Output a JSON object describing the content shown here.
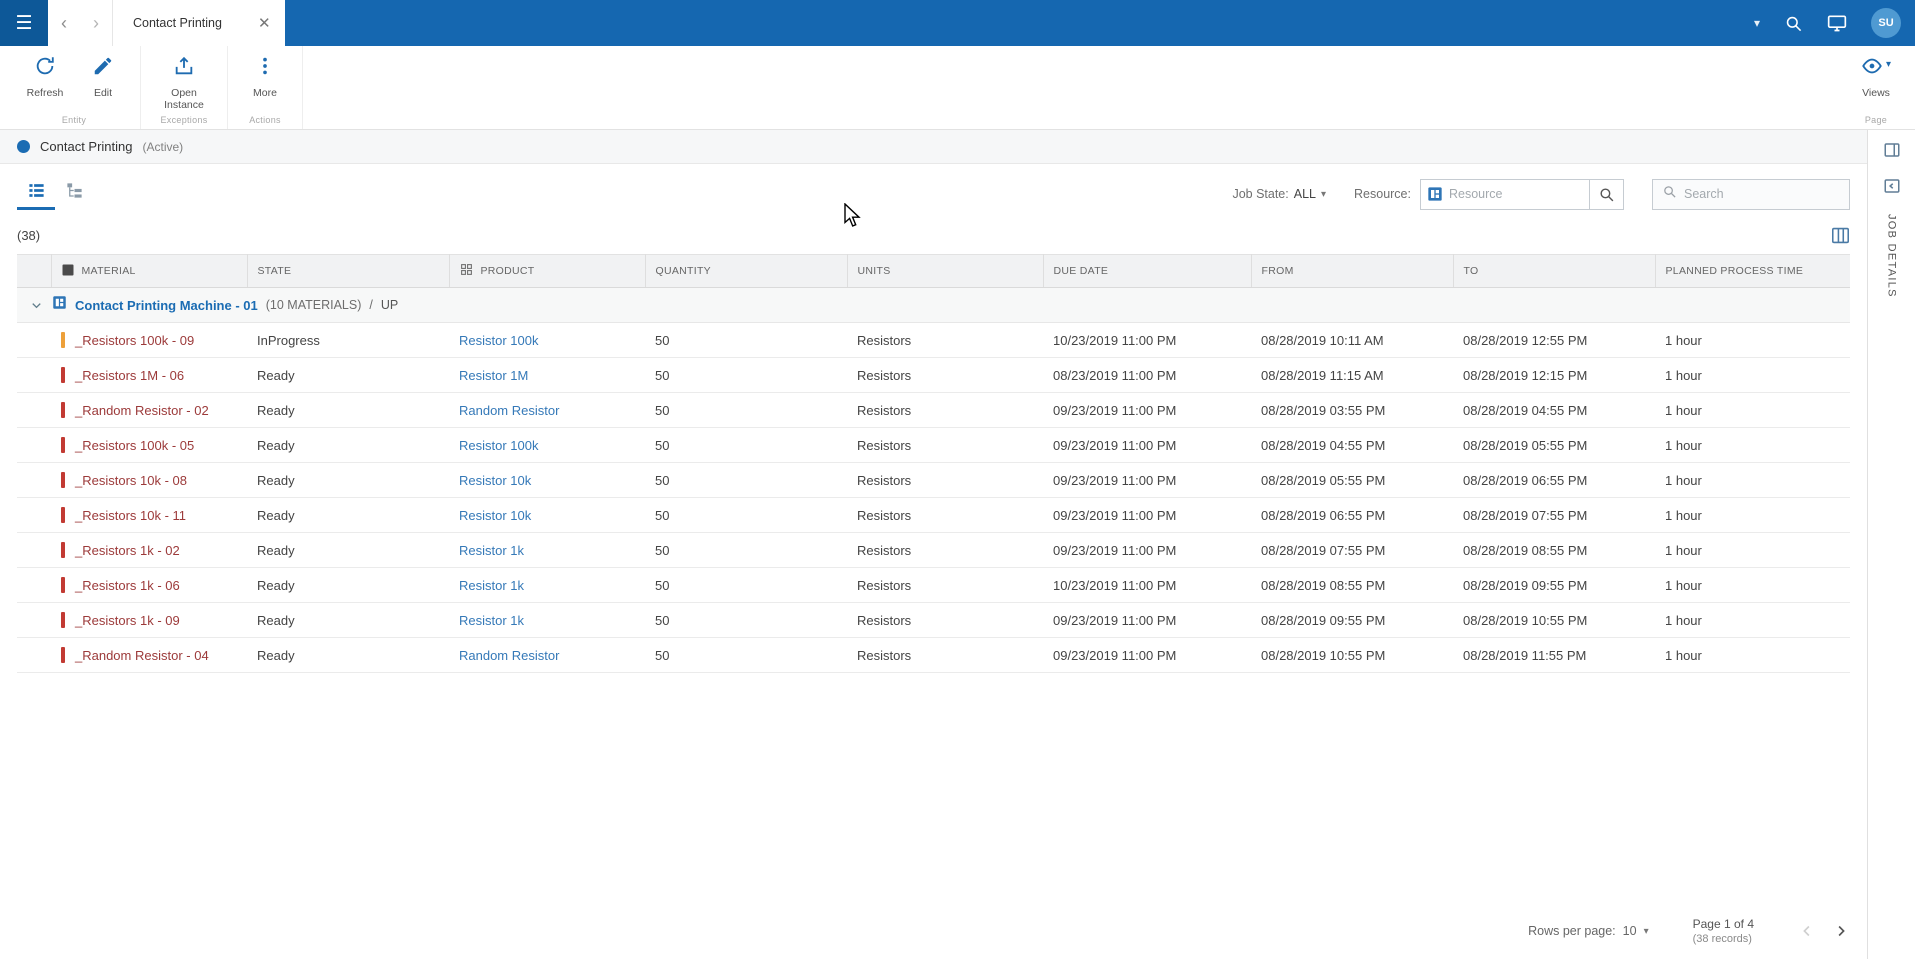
{
  "topbar": {
    "tab_title": "Contact Printing",
    "user_initials": "SU"
  },
  "ribbon": {
    "groups": [
      {
        "label": "Entity",
        "buttons": [
          {
            "label": "Refresh"
          },
          {
            "label": "Edit"
          }
        ]
      },
      {
        "label": "Exceptions",
        "buttons": [
          {
            "label": "Open Instance"
          }
        ]
      },
      {
        "label": "Actions",
        "buttons": [
          {
            "label": "More"
          }
        ]
      }
    ],
    "right": {
      "views_label": "Views",
      "group_label": "Page"
    }
  },
  "entity_header": {
    "title": "Contact Printing",
    "status": "(Active)"
  },
  "filters": {
    "job_state_label": "Job State:",
    "job_state_value": "ALL",
    "resource_label": "Resource:",
    "resource_placeholder": "Resource",
    "search_placeholder": "Search"
  },
  "grid": {
    "count": "(38)",
    "columns": [
      {
        "label": "MATERIAL",
        "icon": "checkbox-icon"
      },
      {
        "label": "STATE"
      },
      {
        "label": "PRODUCT",
        "icon": "product-icon"
      },
      {
        "label": "QUANTITY"
      },
      {
        "label": "UNITS"
      },
      {
        "label": "DUE DATE"
      },
      {
        "label": "FROM"
      },
      {
        "label": "TO"
      },
      {
        "label": "PLANNED PROCESS TIME"
      }
    ],
    "group": {
      "name": "Contact Printing Machine - 01",
      "materials": "(10 MATERIALS)",
      "sep": "/",
      "state": "UP"
    },
    "rows": [
      {
        "material": "_Resistors 100k - 09",
        "state": "InProgress",
        "product": "Resistor 100k",
        "quantity": "50",
        "units": "Resistors",
        "due_date": "10/23/2019 11:00 PM",
        "from": "08/28/2019 10:11 AM",
        "to": "08/28/2019 12:55 PM",
        "planned_process_time": "1 hour",
        "bar": "bar_inprogress"
      },
      {
        "material": "_Resistors 1M - 06",
        "state": "Ready",
        "product": "Resistor 1M",
        "quantity": "50",
        "units": "Resistors",
        "due_date": "08/23/2019 11:00 PM",
        "from": "08/28/2019 11:15 AM",
        "to": "08/28/2019 12:15 PM",
        "planned_process_time": "1 hour",
        "bar": "bar_ready"
      },
      {
        "material": "_Random Resistor - 02",
        "state": "Ready",
        "product": "Random Resistor",
        "quantity": "50",
        "units": "Resistors",
        "due_date": "09/23/2019 11:00 PM",
        "from": "08/28/2019 03:55 PM",
        "to": "08/28/2019 04:55 PM",
        "planned_process_time": "1 hour",
        "bar": "bar_ready"
      },
      {
        "material": "_Resistors 100k - 05",
        "state": "Ready",
        "product": "Resistor 100k",
        "quantity": "50",
        "units": "Resistors",
        "due_date": "09/23/2019 11:00 PM",
        "from": "08/28/2019 04:55 PM",
        "to": "08/28/2019 05:55 PM",
        "planned_process_time": "1 hour",
        "bar": "bar_ready"
      },
      {
        "material": "_Resistors 10k - 08",
        "state": "Ready",
        "product": "Resistor 10k",
        "quantity": "50",
        "units": "Resistors",
        "due_date": "09/23/2019 11:00 PM",
        "from": "08/28/2019 05:55 PM",
        "to": "08/28/2019 06:55 PM",
        "planned_process_time": "1 hour",
        "bar": "bar_ready"
      },
      {
        "material": "_Resistors 10k - 11",
        "state": "Ready",
        "product": "Resistor 10k",
        "quantity": "50",
        "units": "Resistors",
        "due_date": "09/23/2019 11:00 PM",
        "from": "08/28/2019 06:55 PM",
        "to": "08/28/2019 07:55 PM",
        "planned_process_time": "1 hour",
        "bar": "bar_ready"
      },
      {
        "material": "_Resistors 1k - 02",
        "state": "Ready",
        "product": "Resistor 1k",
        "quantity": "50",
        "units": "Resistors",
        "due_date": "09/23/2019 11:00 PM",
        "from": "08/28/2019 07:55 PM",
        "to": "08/28/2019 08:55 PM",
        "planned_process_time": "1 hour",
        "bar": "bar_ready"
      },
      {
        "material": "_Resistors 1k - 06",
        "state": "Ready",
        "product": "Resistor 1k",
        "quantity": "50",
        "units": "Resistors",
        "due_date": "10/23/2019 11:00 PM",
        "from": "08/28/2019 08:55 PM",
        "to": "08/28/2019 09:55 PM",
        "planned_process_time": "1 hour",
        "bar": "bar_ready"
      },
      {
        "material": "_Resistors 1k - 09",
        "state": "Ready",
        "product": "Resistor 1k",
        "quantity": "50",
        "units": "Resistors",
        "due_date": "09/23/2019 11:00 PM",
        "from": "08/28/2019 09:55 PM",
        "to": "08/28/2019 10:55 PM",
        "planned_process_time": "1 hour",
        "bar": "bar_ready"
      },
      {
        "material": "_Random Resistor - 04",
        "state": "Ready",
        "product": "Random Resistor",
        "quantity": "50",
        "units": "Resistors",
        "due_date": "09/23/2019 11:00 PM",
        "from": "08/28/2019 10:55 PM",
        "to": "08/28/2019 11:55 PM",
        "planned_process_time": "1 hour",
        "bar": "bar_ready"
      }
    ]
  },
  "pagination": {
    "rows_per_page_label": "Rows per page:",
    "rows_per_page_value": "10",
    "page_info": "Page 1 of 4",
    "records": "(38 records)"
  },
  "sidebar": {
    "title": "JOB DETAILS"
  },
  "colors": {
    "accent": "#1567b0",
    "bar_inprogress": "#eda03a",
    "bar_ready": "#c23a33",
    "material_text": "#9c3a3a",
    "product_link": "#3579b8"
  }
}
